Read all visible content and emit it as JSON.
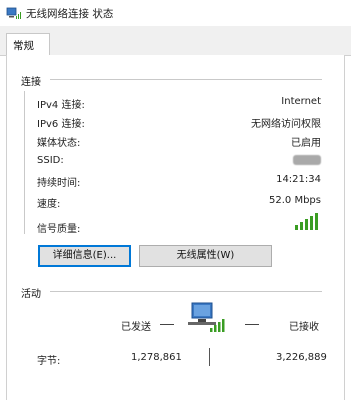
{
  "window": {
    "title": "无线网络连接 状态"
  },
  "tabs": [
    {
      "label": "常规"
    }
  ],
  "connection": {
    "title": "连接",
    "rows": [
      {
        "label": "IPv4 连接:",
        "value": "Internet"
      },
      {
        "label": "IPv6 连接:",
        "value": "无网络访问权限"
      },
      {
        "label": "媒体状态:",
        "value": "已启用"
      },
      {
        "label": "SSID:",
        "value": ""
      },
      {
        "label": "持续时间:",
        "value": "14:21:34"
      },
      {
        "label": "速度:",
        "value": "52.0 Mbps"
      },
      {
        "label": "信号质量:",
        "value": ""
      }
    ],
    "signal_bars_filled": 5,
    "signal_bars_total": 5
  },
  "buttons": {
    "details": "详细信息(E)...",
    "wireless_properties": "无线属性(W)"
  },
  "activity": {
    "title": "活动",
    "sent_label": "已发送",
    "received_label": "已接收",
    "bytes_label": "字节:",
    "bytes_sent": "1,278,861",
    "bytes_received": "3,226,889"
  },
  "colors": {
    "accent": "#0078d7",
    "signal": "#3a9d23"
  }
}
